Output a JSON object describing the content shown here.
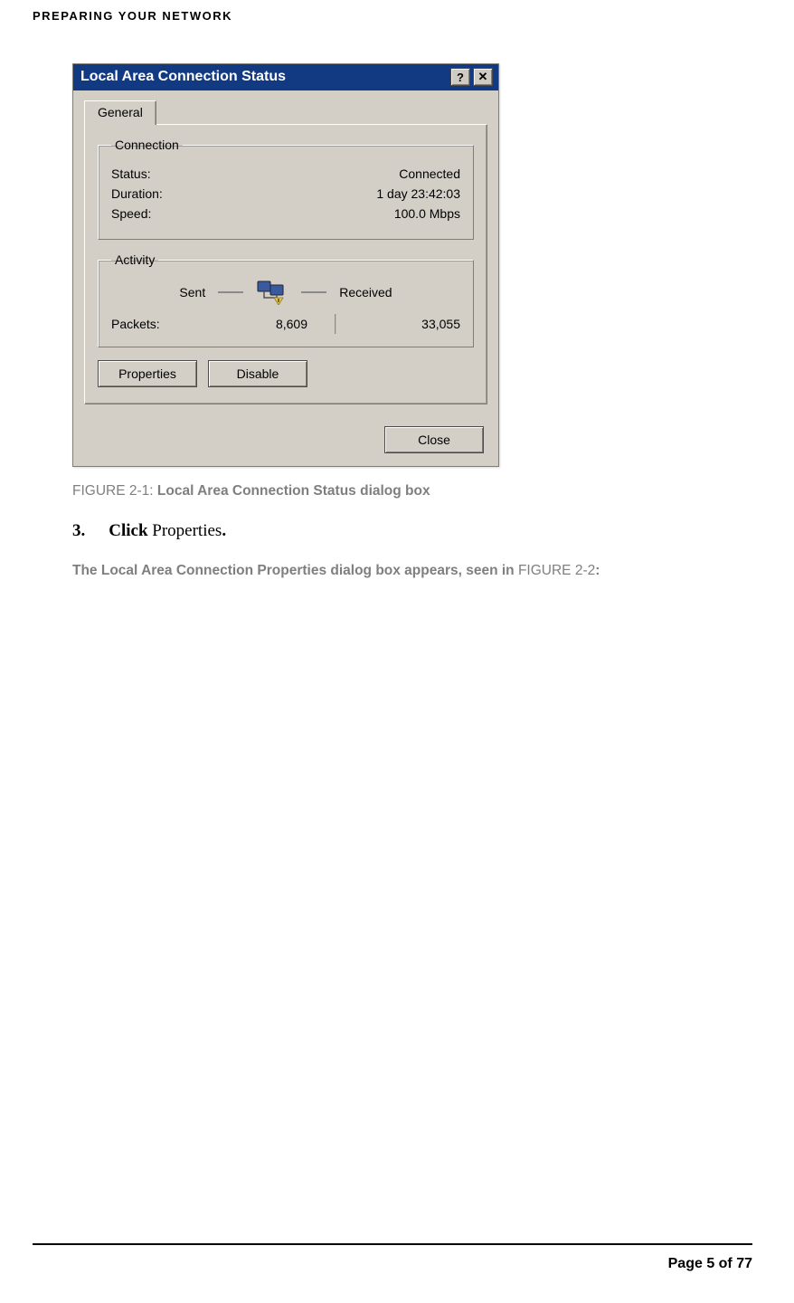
{
  "chapterTitle": "PREPARING YOUR NETWORK",
  "dialog": {
    "title": "Local Area Connection Status",
    "helpGlyph": "?",
    "closeGlyph": "✕",
    "tab": "General",
    "connection": {
      "legend": "Connection",
      "statusLabel": "Status:",
      "statusValue": "Connected",
      "durationLabel": "Duration:",
      "durationValue": "1 day 23:42:03",
      "speedLabel": "Speed:",
      "speedValue": "100.0 Mbps"
    },
    "activity": {
      "legend": "Activity",
      "sentLabel": "Sent",
      "receivedLabel": "Received",
      "packetsLabel": "Packets:",
      "packetsSent": "8,609",
      "packetsReceived": "33,055"
    },
    "buttons": {
      "properties": "Properties",
      "disable": "Disable",
      "close": "Close"
    }
  },
  "captionPrefix": "FIGURE 2-1",
  "captionSep": ": ",
  "captionText": "Local Area Connection Status dialog box",
  "step": {
    "number": "3.",
    "action": "Click",
    "object": "Properties",
    "period": "."
  },
  "resultTextA": "The Local Area Connection Properties dialog box appears, seen in ",
  "resultFigRef": "FIGURE 2-2",
  "resultTextB": ":",
  "footer": "Page 5 of 77"
}
